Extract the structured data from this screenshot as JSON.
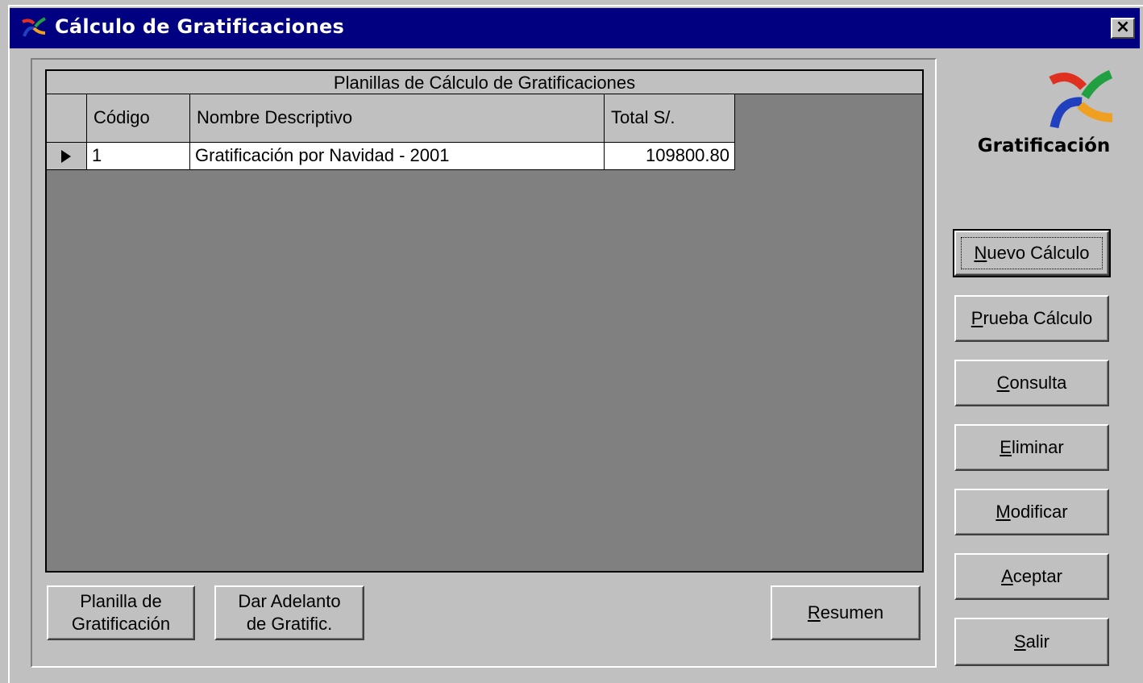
{
  "window": {
    "title": "Cálculo de Gratificaciones",
    "close_label": "×"
  },
  "grid": {
    "caption": "Planillas de Cálculo de Gratificaciones",
    "columns": [
      "Código",
      "Nombre Descriptivo",
      "Total S/."
    ],
    "rows": [
      {
        "codigo": "1",
        "nombre": "Gratificación  por Navidad - 2001",
        "total": "109800.80"
      }
    ]
  },
  "brand": {
    "label": "Gratificación",
    "icon": "gratificacion-logo-icon",
    "colors": [
      "#e03020",
      "#f0a020",
      "#20a040",
      "#2040c0"
    ]
  },
  "side_buttons": {
    "nuevo": {
      "label_u": "N",
      "label_rest": "uevo Cálculo"
    },
    "prueba": {
      "label_u": "P",
      "label_rest": "rueba Cálculo"
    },
    "consulta": {
      "label_u": "C",
      "label_rest": "onsulta"
    },
    "eliminar": {
      "label_u": "E",
      "label_rest": "liminar"
    },
    "modificar": {
      "label_u": "M",
      "label_rest": "odificar"
    },
    "aceptar": {
      "label_u": "A",
      "label_rest": "ceptar"
    },
    "salir": {
      "label_u": "S",
      "label_rest": "alir"
    }
  },
  "bottom_buttons": {
    "planilla_line1": "Planilla de",
    "planilla_line2": "Gratificación",
    "adelanto_line1": "Dar Adelanto",
    "adelanto_line2": "de Gratific.",
    "resumen": {
      "label_u": "R",
      "label_rest": "esumen"
    }
  },
  "colors": {
    "titlebar": "#000080",
    "face": "#c0c0c0",
    "grid_background": "#808080"
  }
}
